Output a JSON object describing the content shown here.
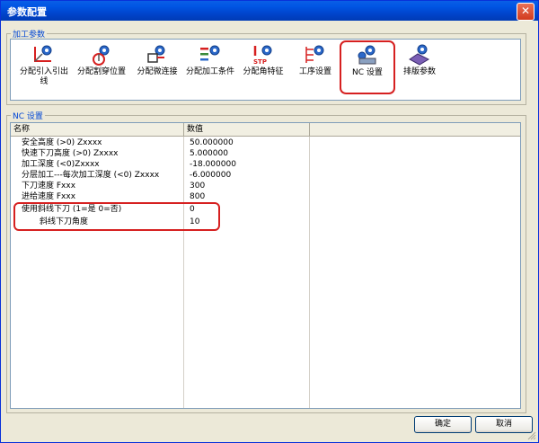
{
  "window": {
    "title": "参数配置",
    "close_glyph": "✕"
  },
  "processing_group": {
    "legend": "加工参数",
    "tools": [
      {
        "label": "分配引入引出线",
        "icon": "lead-in-out-icon"
      },
      {
        "label": "分配割穿位置",
        "icon": "pierce-position-icon"
      },
      {
        "label": "分配微连接",
        "icon": "micro-joint-icon"
      },
      {
        "label": "分配加工条件",
        "icon": "cutting-condition-icon"
      },
      {
        "label": "分配角特征",
        "icon": "corner-feature-icon"
      },
      {
        "label": "工序设置",
        "icon": "process-setting-icon"
      },
      {
        "label": "NC 设置",
        "icon": "nc-setting-icon",
        "active": true
      },
      {
        "label": "排版参数",
        "icon": "nesting-parameter-icon"
      }
    ]
  },
  "nc_group": {
    "legend": "NC 设置",
    "columns": [
      "名称",
      "数值"
    ],
    "rows": [
      {
        "name": "安全高度 (>0) Zxxxx",
        "value": "50.000000"
      },
      {
        "name": "快速下刀高度 (>0) Zxxxx",
        "value": "5.000000"
      },
      {
        "name": "加工深度 (<0)Zxxxx",
        "value": "-18.000000"
      },
      {
        "name": "分层加工---每次加工深度 (<0) Zxxxx",
        "value": "-6.000000"
      },
      {
        "name": "下刀速度 Fxxx",
        "value": "300"
      },
      {
        "name": "进给速度 Fxxx",
        "value": "800"
      },
      {
        "name": "使用斜线下刀 (1=是 0=否)",
        "value": "0"
      },
      {
        "name": "斜线下刀角度",
        "value": "10"
      }
    ]
  },
  "buttons": {
    "ok": "确定",
    "cancel": "取消"
  }
}
